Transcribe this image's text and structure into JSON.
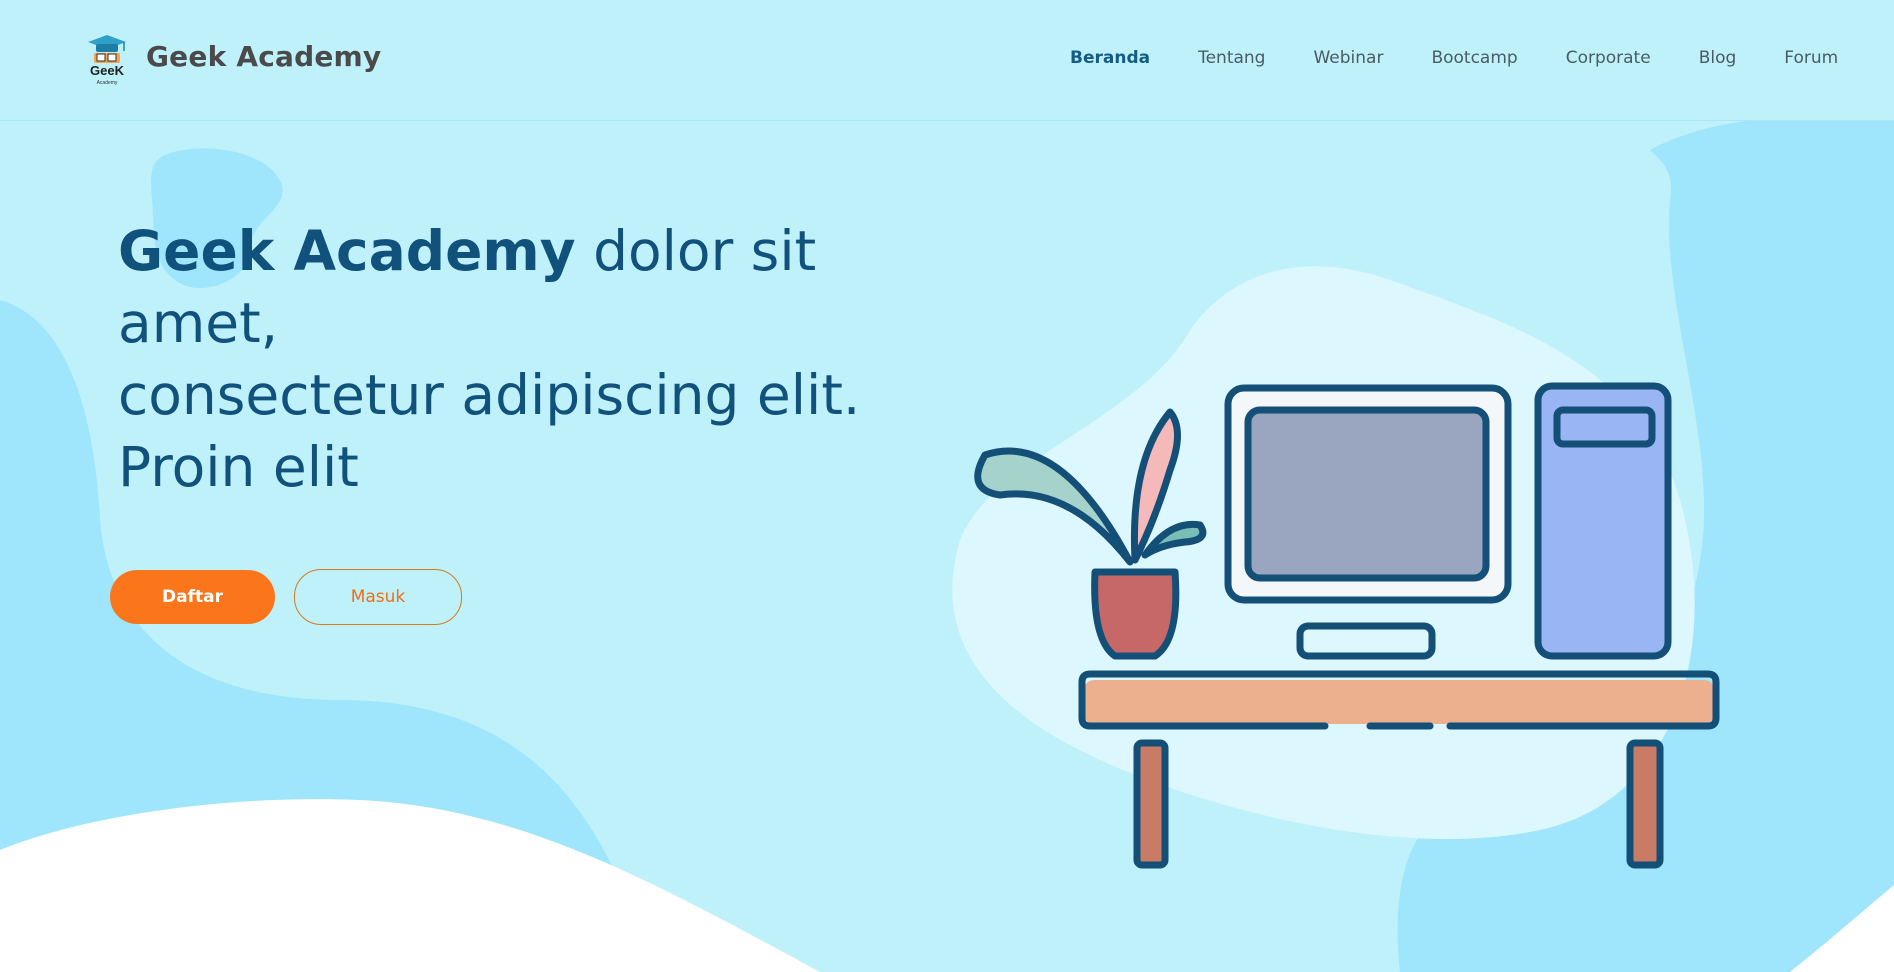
{
  "brand": {
    "name": "Geek Academy",
    "logo_text": "GeeK",
    "logo_subtext": "Academy"
  },
  "nav": {
    "items": [
      {
        "label": "Beranda",
        "active": true
      },
      {
        "label": "Tentang",
        "active": false
      },
      {
        "label": "Webinar",
        "active": false
      },
      {
        "label": "Bootcamp",
        "active": false
      },
      {
        "label": "Corporate",
        "active": false
      },
      {
        "label": "Blog",
        "active": false
      },
      {
        "label": "Forum",
        "active": false
      }
    ]
  },
  "hero": {
    "title_bold": "Geek Academy",
    "title_line1_rest": " dolor sit amet,",
    "title_line2": "consectetur adipiscing elit.",
    "title_line3": "Proin elit",
    "primary_button": "Daftar",
    "secondary_button": "Masuk"
  },
  "colors": {
    "background": "#bff1fb",
    "blob": "#9fe6fc",
    "accent": "#fb751b",
    "title": "#11527c",
    "nav_active": "#155c85"
  },
  "icons": {
    "logo": "graduation-cap-logo",
    "illustration": "desk-computer-plant-illustration"
  }
}
